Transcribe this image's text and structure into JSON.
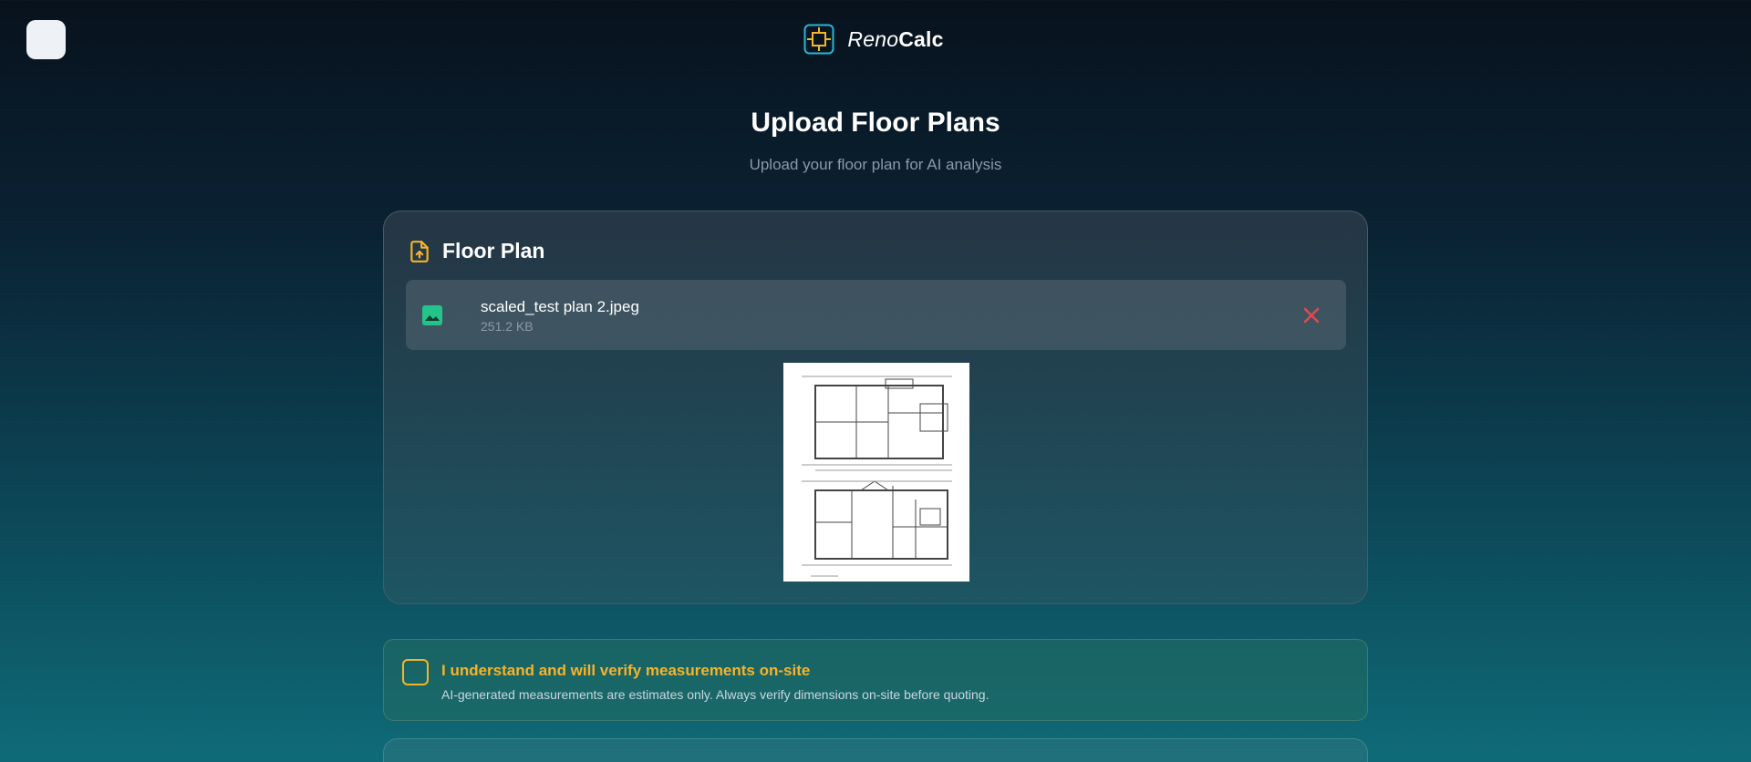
{
  "header": {
    "brand_italic": "Reno",
    "brand_bold": "Calc"
  },
  "main": {
    "title": "Upload Floor Plans",
    "subtitle": "Upload your floor plan for AI analysis"
  },
  "floor_plan_card": {
    "title": "Floor Plan",
    "file": {
      "name": "scaled_test plan 2.jpeg",
      "size": "251.2 KB"
    }
  },
  "acknowledgement": {
    "checked": false,
    "title": "I understand and will verify measurements on-site",
    "description": "AI-generated measurements are estimates only. Always verify dimensions on-site before quoting."
  },
  "icons": {
    "menu": "menu-button",
    "logo": "renocalc-logo-icon",
    "upload": "file-upload-icon",
    "file": "image-file-icon",
    "remove": "close-icon"
  },
  "colors": {
    "accent": "#f5b42a",
    "logo_cyan": "#2bb5d6",
    "file_icon_green": "#23c48a",
    "remove_red": "#e5484d"
  }
}
